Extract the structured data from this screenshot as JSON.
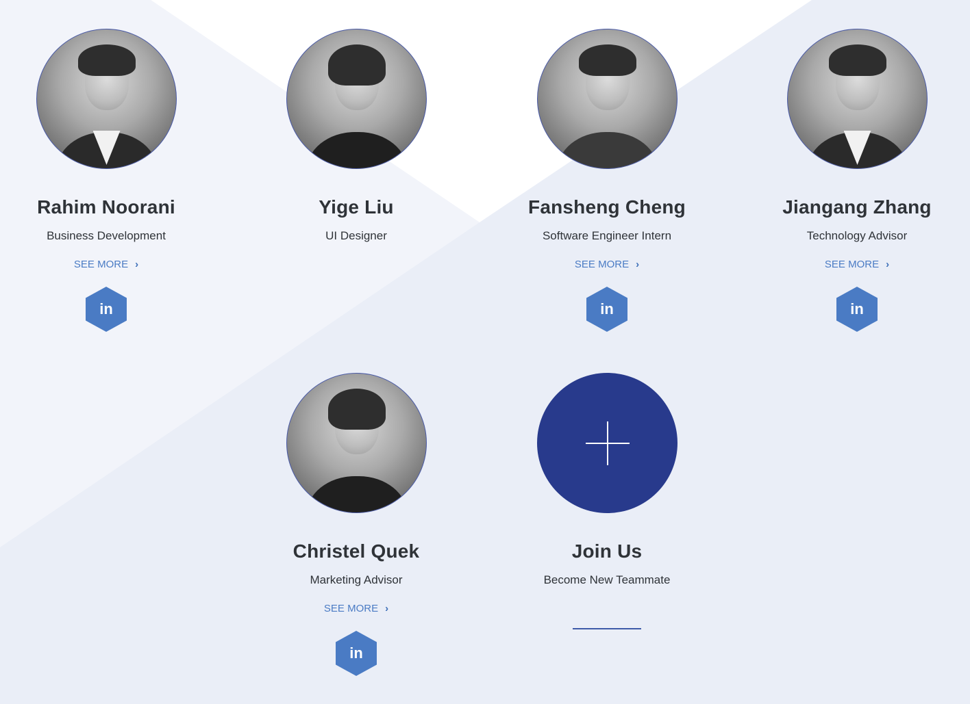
{
  "colors": {
    "background": "#eaeef7",
    "accent": "#4a7bc4",
    "join_circle": "#283a8c",
    "text": "#2f3338"
  },
  "members": [
    {
      "name": "Rahim Noorani",
      "role": "Business Development",
      "see_more": "SEE MORE",
      "linkedin": "in"
    },
    {
      "name": "Yige Liu",
      "role": "UI Designer"
    },
    {
      "name": "Fansheng Cheng",
      "role": "Software Engineer Intern",
      "see_more": "SEE MORE",
      "linkedin": "in"
    },
    {
      "name": "Jiangang Zhang",
      "role": "Technology Advisor",
      "see_more": "SEE MORE",
      "linkedin": "in"
    },
    {
      "name": "Christel Quek",
      "role": "Marketing Advisor",
      "see_more": "SEE MORE",
      "linkedin": "in"
    }
  ],
  "join": {
    "title": "Join Us",
    "subtitle": "Become New Teammate",
    "icon": "plus-icon"
  }
}
